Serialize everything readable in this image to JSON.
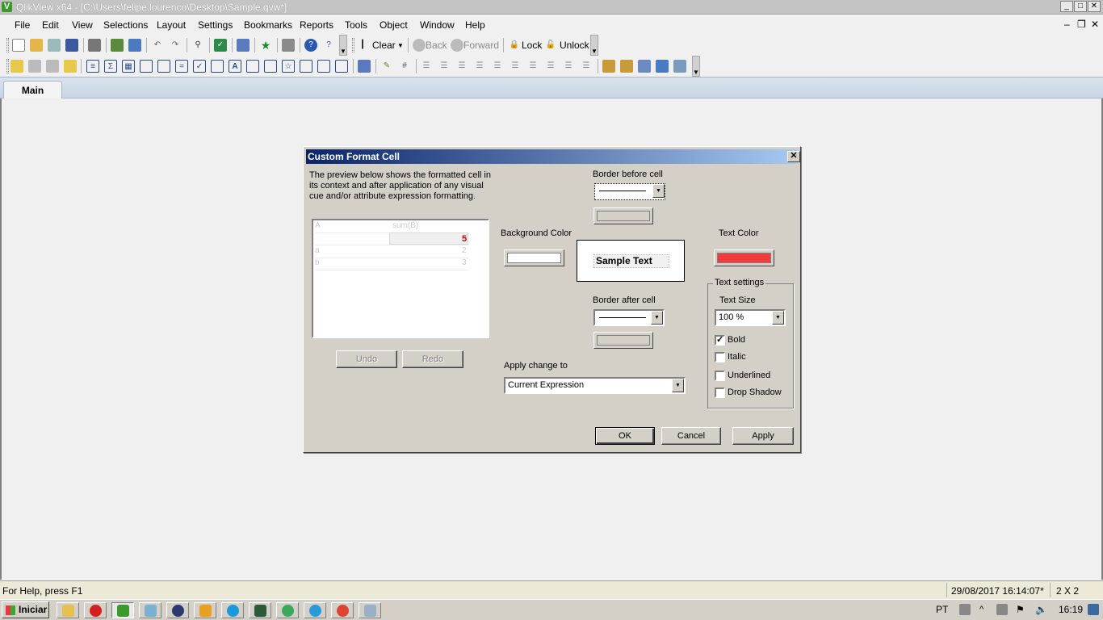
{
  "window": {
    "title": "QlikView x64 - [C:\\Users\\felipe.lourenco\\Desktop\\Sample.qvw*]",
    "minimize": "_",
    "maximize": "□",
    "close": "✕"
  },
  "menu": [
    "File",
    "Edit",
    "View",
    "Selections",
    "Layout",
    "Settings",
    "Bookmarks",
    "Reports",
    "Tools",
    "Object",
    "Window",
    "Help"
  ],
  "toolbar": {
    "clear": "Clear",
    "back": "Back",
    "forward": "Forward",
    "lock": "Lock",
    "unlock": "Unlock"
  },
  "tabs": [
    {
      "label": "Main"
    }
  ],
  "dialog": {
    "title": "Custom Format Cell",
    "description": "The preview below shows the formatted cell in its context and after application of any visual cue and/or attribute expression formatting.",
    "preview": {
      "headers": [
        "A",
        "sum(B)"
      ],
      "total": "5",
      "rows": [
        {
          "a": "a",
          "b": "2"
        },
        {
          "a": "b",
          "b": "3"
        }
      ]
    },
    "undo": "Undo",
    "redo": "Redo",
    "border_before": "Border before cell",
    "background_color": "Background Color",
    "text_color": "Text Color",
    "sample_text": "Sample Text",
    "border_after": "Border after cell",
    "apply_change_to": "Apply change to",
    "apply_target": "Current Expression",
    "text_settings": {
      "title": "Text settings",
      "size_label": "Text Size",
      "size_value": "100 %",
      "bold": "Bold",
      "italic": "Italic",
      "underlined": "Underlined",
      "drop_shadow": "Drop Shadow",
      "bold_checked": true,
      "italic_checked": false,
      "underlined_checked": false,
      "drop_shadow_checked": false
    },
    "ok": "OK",
    "cancel": "Cancel",
    "apply": "Apply",
    "colors": {
      "text": "#f03c3c",
      "background": "#ffffff",
      "accent": "#0a246a",
      "total": "#cc0000"
    }
  },
  "status": {
    "help": "For Help, press F1",
    "timestamp": "29/08/2017 16:14:07*",
    "dimensions": "2 X 2"
  },
  "taskbar": {
    "start": "Iniciar",
    "language": "PT",
    "clock": "16:19"
  }
}
